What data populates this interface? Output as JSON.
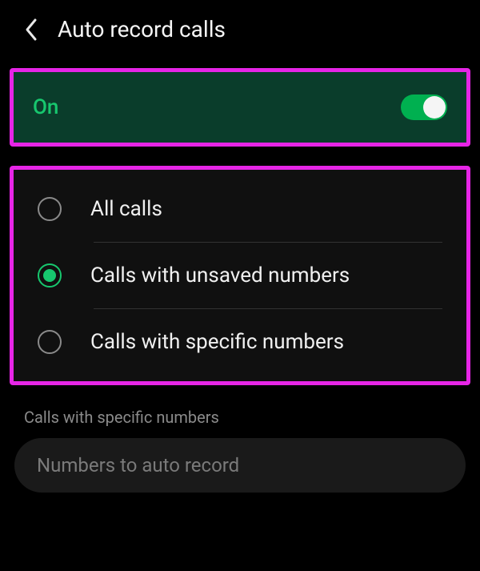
{
  "header": {
    "title": "Auto record calls"
  },
  "toggle": {
    "label": "On",
    "state": "on"
  },
  "options": {
    "items": [
      {
        "label": "All calls",
        "selected": false
      },
      {
        "label": "Calls with unsaved numbers",
        "selected": true
      },
      {
        "label": "Calls with specific numbers",
        "selected": false
      }
    ]
  },
  "specific_section": {
    "heading": "Calls with specific numbers",
    "placeholder": "Numbers to auto record"
  },
  "colors": {
    "highlight": "#e625e6",
    "accent": "#17c76e"
  }
}
